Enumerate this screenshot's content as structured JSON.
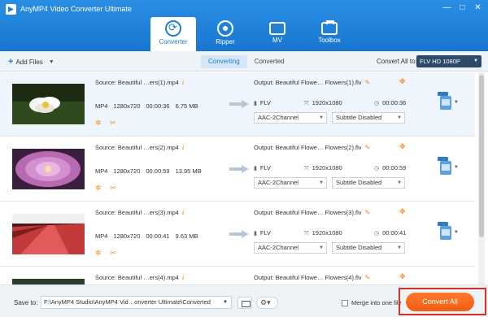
{
  "window": {
    "title": "AnyMP4 Video Converter Ultimate",
    "controls": [
      "—",
      "□",
      "✕"
    ]
  },
  "nav": {
    "tabs": [
      {
        "label": "Converter",
        "icon": "converter-icon",
        "active": true
      },
      {
        "label": "Ripper",
        "icon": "disc-icon",
        "active": false
      },
      {
        "label": "MV",
        "icon": "tv-icon",
        "active": false
      },
      {
        "label": "Toolbox",
        "icon": "toolbox-icon",
        "active": false
      }
    ]
  },
  "toolbar": {
    "add_files": "Add Files",
    "tabs": {
      "converting": "Converting",
      "converted": "Converted"
    },
    "convert_all_to": "Convert All to:",
    "format": "FLV HD 1080P"
  },
  "files": [
    {
      "source": "Source: Beautiful …ers(1).mp4",
      "format": "MP4",
      "resolution": "1280x720",
      "duration": "00:00:36",
      "size": "6.75 MB",
      "output": "Output: Beautiful Flowe… Flowers(1).flv",
      "out_format": "FLV",
      "out_resolution": "1920x1080",
      "out_duration": "00:00:36",
      "audio": "AAC-2Channel",
      "subtitle": "Subtitle Disabled"
    },
    {
      "source": "Source: Beautiful …ers(2).mp4",
      "format": "MP4",
      "resolution": "1280x720",
      "duration": "00:00:59",
      "size": "13.95 MB",
      "output": "Output: Beautiful Flowe… Flowers(2).flv",
      "out_format": "FLV",
      "out_resolution": "1920x1080",
      "out_duration": "00:00:59",
      "audio": "AAC-2Channel",
      "subtitle": "Subtitle Disabled"
    },
    {
      "source": "Source: Beautiful …ers(3).mp4",
      "format": "MP4",
      "resolution": "1280x720",
      "duration": "00:00:41",
      "size": "9.63 MB",
      "output": "Output: Beautiful Flowe… Flowers(3).flv",
      "out_format": "FLV",
      "out_resolution": "1920x1080",
      "out_duration": "00:00:41",
      "audio": "AAC-2Channel",
      "subtitle": "Subtitle Disabled"
    },
    {
      "source": "Source: Beautiful …ers(4).mp4",
      "output": "Output: Beautiful Flowe… Flowers(4).flv"
    }
  ],
  "bottom": {
    "save_to": "Save to:",
    "path": "F:\\AnyMP4 Studio\\AnyMP4 Vid…onverter Ultimate\\Converted",
    "merge": "Merge into one file",
    "convert_all": "Convert All"
  },
  "colors": {
    "accent": "#1f7fd8",
    "convert": "#f25d12",
    "highlight_frame": "#d93025"
  }
}
